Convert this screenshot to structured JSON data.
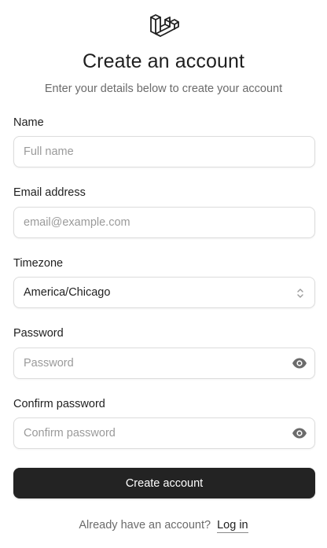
{
  "header": {
    "logo_icon": "laravel-logo-icon",
    "title": "Create an account",
    "subtitle": "Enter your details below to create your account"
  },
  "form": {
    "name": {
      "label": "Name",
      "value": "",
      "placeholder": "Full name"
    },
    "email": {
      "label": "Email address",
      "value": "",
      "placeholder": "email@example.com"
    },
    "timezone": {
      "label": "Timezone",
      "value": "America/Chicago",
      "icon": "chevron-up-down-icon"
    },
    "password": {
      "label": "Password",
      "value": "",
      "placeholder": "Password",
      "icon": "eye-icon"
    },
    "confirm_password": {
      "label": "Confirm password",
      "value": "",
      "placeholder": "Confirm password",
      "icon": "eye-icon"
    },
    "submit_label": "Create account"
  },
  "footer": {
    "question": "Already have an account?",
    "login_label": "Log in"
  },
  "colors": {
    "button_bg": "#232323",
    "border": "#dcdcdc",
    "muted_text": "#6b6b6b",
    "placeholder": "#9a9a9a"
  }
}
